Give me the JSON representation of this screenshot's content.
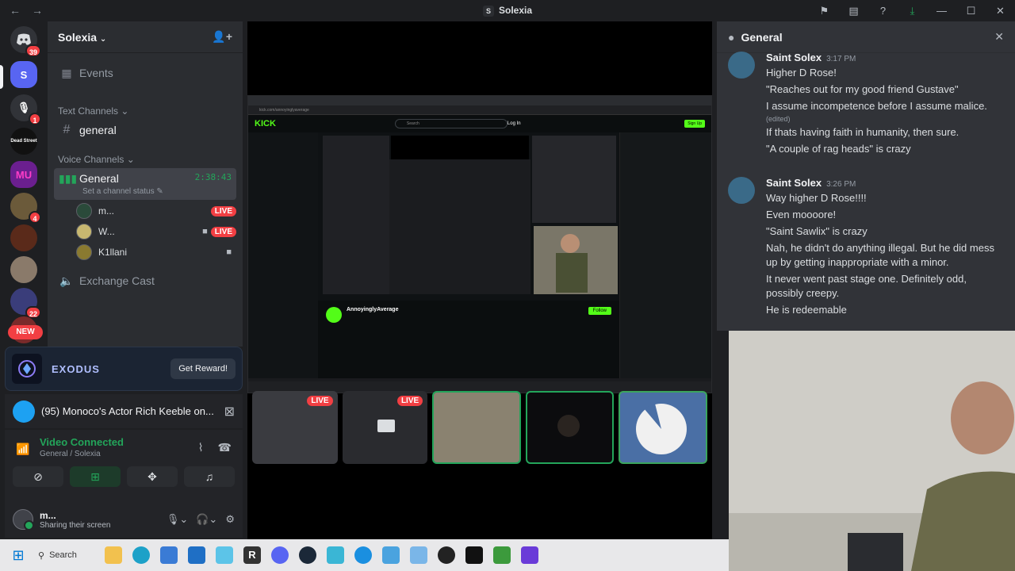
{
  "window": {
    "title": "Solexia",
    "server_initial": "S"
  },
  "guild_badges": {
    "dm": "39",
    "mic_server": "1",
    "g5": "4",
    "g7": "22",
    "new": "NEW"
  },
  "guild_initials": {
    "solexia": "S",
    "mu": "MU",
    "dead_street": "Dead Street"
  },
  "server": {
    "name": "Solexia"
  },
  "sidebar": {
    "events": "Events",
    "text_category": "Text Channels",
    "text_channel": "general",
    "voice_category": "Voice Channels",
    "voice_channel": "General",
    "voice_timer": "2:38:43",
    "voice_status": "Set a channel status",
    "voice_users": [
      {
        "name": "m...",
        "badge": "LIVE"
      },
      {
        "name": "W...",
        "badge": "LIVE"
      },
      {
        "name": "K1llani"
      }
    ],
    "exchange": "Exchange Cast"
  },
  "promo": {
    "brand": "EXODUS",
    "button": "Get Reward!"
  },
  "now_playing": {
    "text": "(95) Monoco's Actor Rich Keeble on..."
  },
  "voice_panel": {
    "status": "Video Connected",
    "location": "General / Solexia"
  },
  "user_panel": {
    "name": "m...",
    "status": "Sharing their screen"
  },
  "stream": {
    "kick_logo": "KICK",
    "search": "Search",
    "login": "Log In",
    "signup": "Sign Up",
    "streamer": "AnnoyinglyAverage",
    "follow": "Follow"
  },
  "thumbs": {
    "live1": "LIVE",
    "live2": "LIVE"
  },
  "chat": {
    "title": "General",
    "messages": [
      {
        "author": "Saint Solex",
        "time": "3:17 PM",
        "lines": [
          "Higher D Rose!",
          "\"Reaches out for my good friend Gustave\"",
          "I assume incompetence before I assume malice.",
          "If thats having faith in humanity, then sure.",
          "\"A couple of rag heads\" is crazy"
        ],
        "edited": "(edited)"
      },
      {
        "author": "Saint Solex",
        "time": "3:26 PM",
        "lines": [
          "Way higher D Rose!!!!",
          "Even moooore!",
          "\"Saint Sawlix\" is crazy",
          "Nah, he didn't do anything illegal. But he did mess up by getting inappropriate with a minor.",
          "It never went past stage one. Definitely odd, possibly creepy.",
          "He is redeemable"
        ]
      }
    ]
  },
  "taskbar": {
    "search": "Search"
  },
  "colors": {
    "accent_green": "#23a55a",
    "live_red": "#f23f43",
    "kick_green": "#53fc18",
    "blurple": "#5865f2"
  }
}
